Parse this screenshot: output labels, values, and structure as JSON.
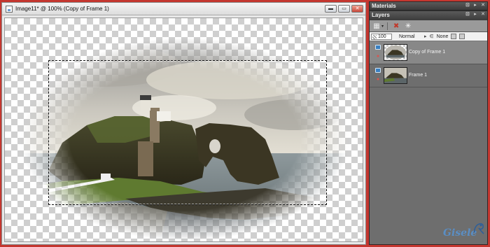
{
  "image_window": {
    "title": "Image11* @ 100% (Copy of Frame 1)",
    "controls": {
      "minimize": "▬",
      "maximize": "▭",
      "close": "✕"
    }
  },
  "materials_panel": {
    "title": "Materials",
    "controls": [
      "⊡",
      "▸",
      "✕"
    ]
  },
  "layers_panel": {
    "title": "Layers",
    "controls": [
      "⊡",
      "▸",
      "✕"
    ],
    "toolbar": {
      "new_layer_icon": "new-layer-icon",
      "delete_layer_icon": "delete-layer-icon",
      "effects_icon": "effects-icon"
    },
    "properties": {
      "opacity": "100",
      "blend_mode": "Normal",
      "link_mode": "None"
    },
    "layers": [
      {
        "name": "Copy of Frame 1",
        "selected": true
      },
      {
        "name": "Frame 1",
        "selected": false
      }
    ]
  },
  "signature": "Gisele",
  "colors": {
    "window_border": "#c4362f",
    "panel_bg": "#6e6e6e",
    "selected_layer": "#888888",
    "signature": "#5a8ec4"
  }
}
